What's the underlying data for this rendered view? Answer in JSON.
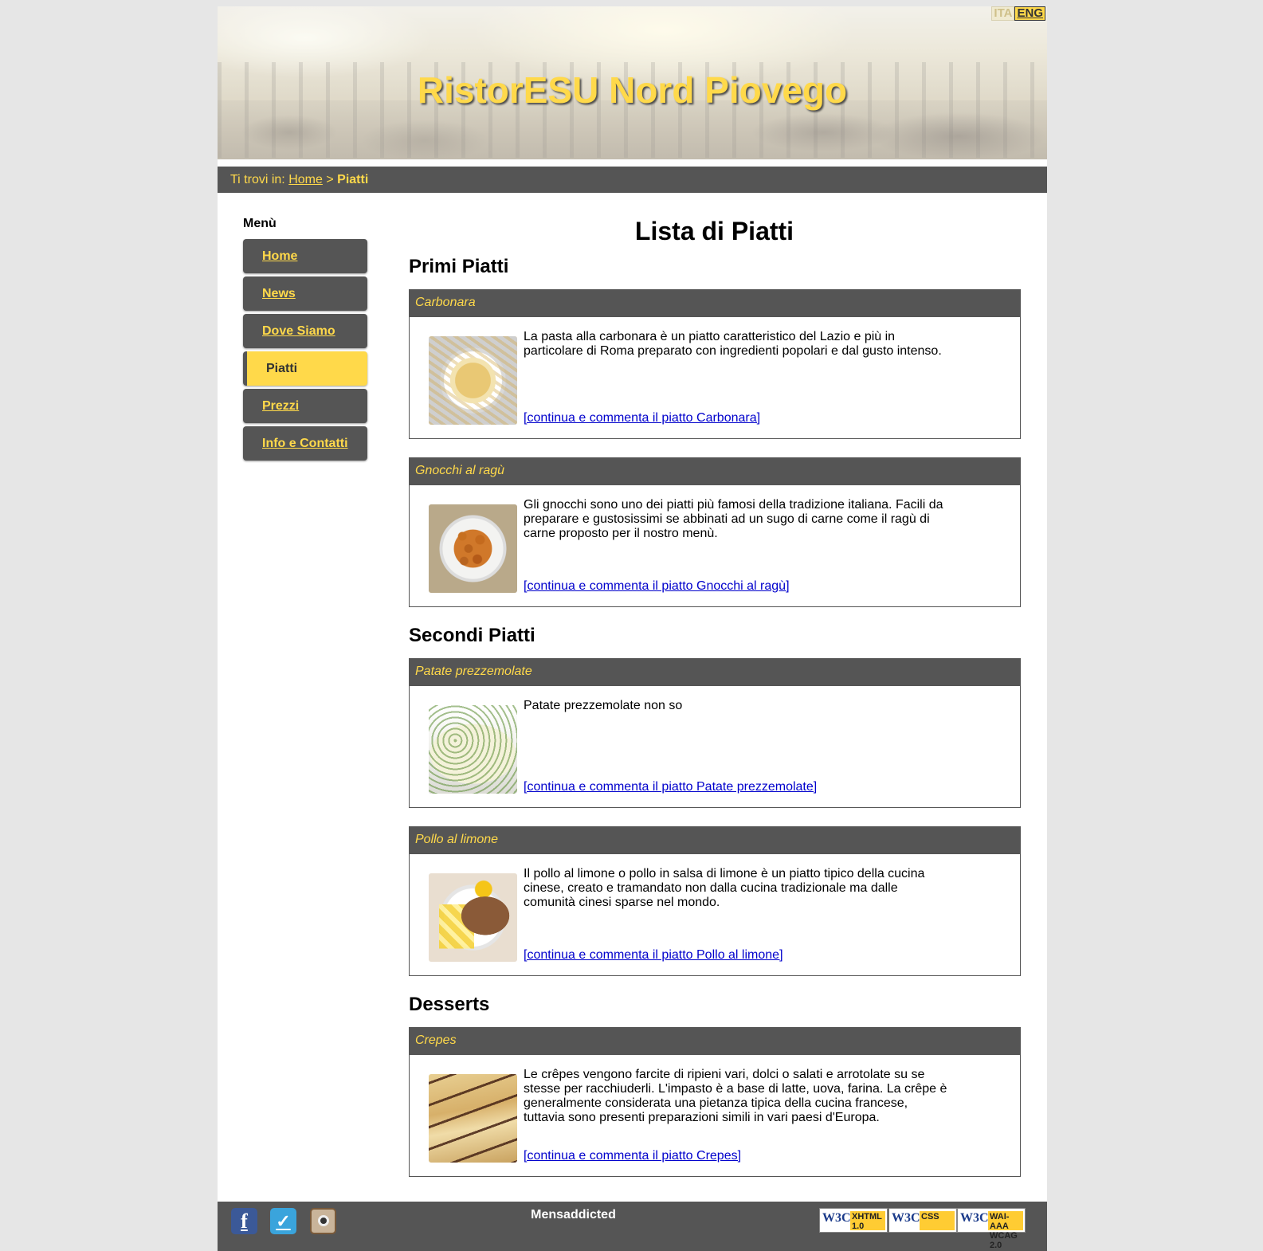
{
  "header": {
    "site_title": "RistorESU Nord Piovego",
    "languages": [
      {
        "label": "ITA",
        "active": false
      },
      {
        "label": "ENG",
        "active": true
      }
    ]
  },
  "breadcrumb": {
    "prefix": "Ti trovi in:",
    "home_link": "Home",
    "separator": ">",
    "current": "Piatti"
  },
  "menu": {
    "title": "Menù",
    "items": [
      {
        "label": "Home",
        "active": false
      },
      {
        "label": "News",
        "active": false
      },
      {
        "label": "Dove Siamo",
        "active": false
      },
      {
        "label": "Piatti",
        "active": true
      },
      {
        "label": "Prezzi",
        "active": false
      },
      {
        "label": "Info e Contatti",
        "active": false
      }
    ]
  },
  "main": {
    "title": "Lista di Piatti",
    "sections": [
      {
        "title": "Primi Piatti",
        "dishes": [
          {
            "name": "Carbonara",
            "photo": "carbonara-photo",
            "description": "La pasta alla carbonara è un piatto caratteristico del Lazio e più in particolare di Roma preparato con ingredienti popolari e dal gusto intenso.",
            "link": "[continua e commenta il piatto Carbonara]"
          },
          {
            "name": "Gnocchi al ragù",
            "photo": "gnocchi-photo",
            "description": "Gli gnocchi sono uno dei piatti più famosi della tradizione italiana. Facili da preparare e gustosissimi se abbinati ad un sugo di carne come il ragù di carne proposto per il nostro menù.",
            "link": "[continua e commenta il piatto Gnocchi al ragù]"
          }
        ]
      },
      {
        "title": "Secondi Piatti",
        "dishes": [
          {
            "name": "Patate prezzemolate",
            "photo": "patate-photo",
            "description": "Patate prezzemolate non so",
            "link": "[continua e commenta il piatto Patate prezzemolate]"
          },
          {
            "name": "Pollo al limone",
            "photo": "pollo-photo",
            "description": "Il pollo al limone o pollo in salsa di limone è un piatto tipico della cucina cinese, creato e tramandato non dalla cucina tradizionale ma dalle comunità cinesi sparse nel mondo.",
            "link": "[continua e commenta il piatto Pollo al limone]"
          }
        ]
      },
      {
        "title": "Desserts",
        "dishes": [
          {
            "name": "Crepes",
            "photo": "crepes-photo",
            "description": "Le crêpes vengono farcite di ripieni vari, dolci o salati e arrotolate su se stesse per racchiuderli. L'impasto è a base di latte, uova, farina. La crêpe è generalmente considerata una pietanza tipica della cucina francese, tuttavia sono presenti preparazioni simili in vari paesi d'Europa.",
            "link": "[continua e commenta il piatto Crepes]"
          }
        ]
      }
    ]
  },
  "footer": {
    "title": "Mensaddicted",
    "social_icons": [
      "facebook-icon",
      "foursquare-icon",
      "instagram-icon"
    ],
    "social_glyphs": {
      "facebook": "f",
      "foursquare": "✓"
    },
    "badges": [
      {
        "logo": "W3C",
        "tag": "XHTML 1.0"
      },
      {
        "logo": "W3C",
        "tag": "CSS"
      },
      {
        "logo": "W3C",
        "tag": "WAI-AAA WCAG 2.0"
      }
    ]
  },
  "colors": {
    "accent_yellow": "#ffd94a",
    "bar_gray": "#555555",
    "link_blue": "#0000cc",
    "page_bg": "#e6e6e6"
  }
}
